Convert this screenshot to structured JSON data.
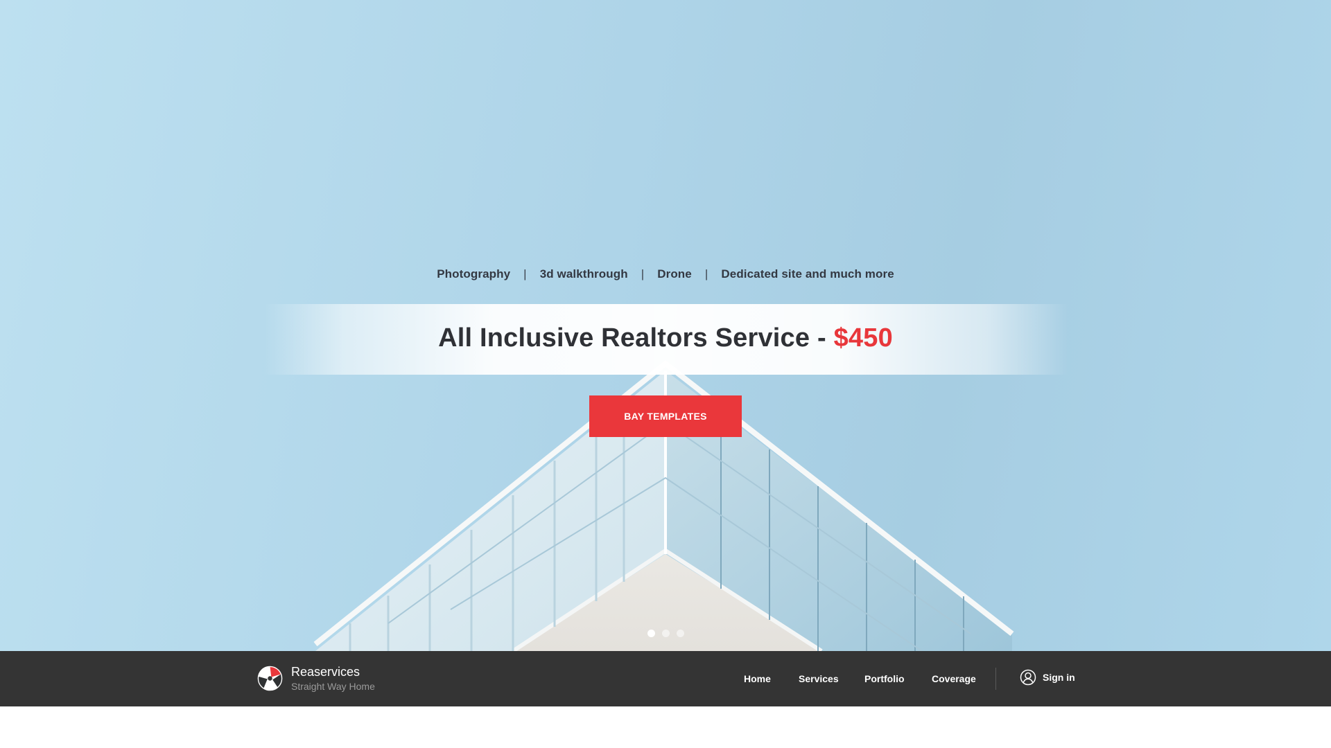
{
  "hero": {
    "services": [
      "Photography",
      "3d walkthrough",
      "Drone",
      "Dedicated site and much more"
    ],
    "separator": "|",
    "title": "All Inclusive Realtors Service -",
    "price": "$450",
    "cta_label": "BAY TEMPLATES",
    "slider": {
      "slides": 3,
      "active_index": 0
    }
  },
  "navbar": {
    "brand_name": "Reaservices",
    "brand_tagline": "Straight Way Home",
    "items": [
      "Home",
      "Services",
      "Portfolio",
      "Coverage"
    ],
    "signin_label": "Sign in"
  },
  "icons": {
    "logo": "camera-aperture-icon",
    "signin": "user-circle-icon"
  },
  "colors": {
    "accent": "#ea373b",
    "navbar_bg": "#343434",
    "hero_sky": "#aed4e8"
  }
}
